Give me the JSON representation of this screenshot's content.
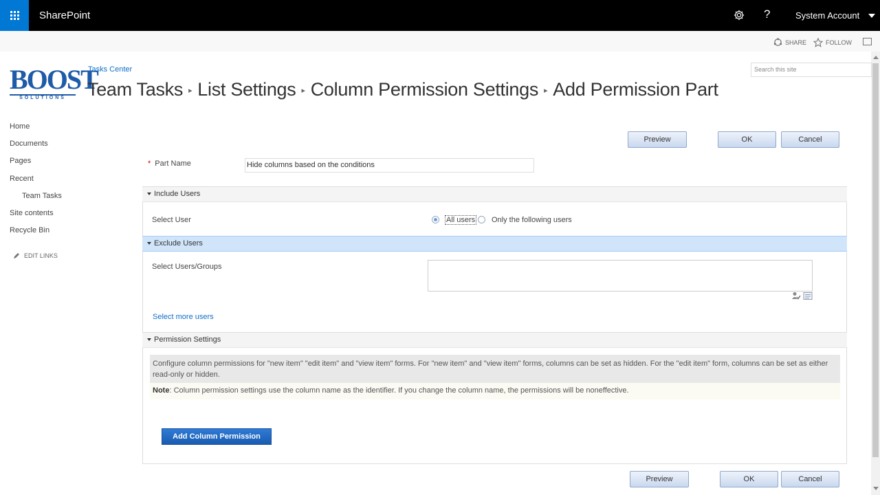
{
  "suite": {
    "brand": "SharePoint",
    "account": "System Account",
    "help": "?"
  },
  "ribbon": {
    "share": "SHARE",
    "follow": "FOLLOW"
  },
  "logo": {
    "main": "BOOST",
    "sub": "SOLUTIONS"
  },
  "header": {
    "site_title": "Tasks Center",
    "breadcrumb": [
      "Team Tasks",
      "List Settings",
      "Column Permission Settings",
      "Add Permission Part"
    ],
    "search_placeholder": "Search this site"
  },
  "nav": {
    "items": [
      "Home",
      "Documents",
      "Pages",
      "Recent",
      "Team Tasks",
      "Site contents",
      "Recycle Bin"
    ],
    "edit_links": "EDIT LINKS"
  },
  "buttons": {
    "preview": "Preview",
    "ok": "OK",
    "cancel": "Cancel",
    "add_column_permission": "Add Column Permission"
  },
  "form": {
    "part_name_label": "Part Name",
    "part_name_required": "*",
    "part_name_value": "Hide columns based on the conditions",
    "include_users": {
      "header": "Include Users",
      "select_user_label": "Select User",
      "options": [
        "All users",
        "Only the following users"
      ],
      "selected": "All users"
    },
    "exclude_users": {
      "header": "Exclude Users",
      "select_users_groups_label": "Select Users/Groups",
      "select_more_users": "Select more users"
    },
    "permission_settings": {
      "header": "Permission Settings",
      "description": "Configure column permissions for \"new item\" \"edit item\" and \"view item\" forms. For \"new item\" and \"view item\" forms, columns can be set as hidden. For the \"edit item\" form, columns can be set as either read-only or hidden.",
      "note_label": "Note",
      "note_text": ": Column permission settings use the column name as the identifier. If you change the column name, the permissions will be noneffective."
    }
  },
  "colors": {
    "suite_bar": "#000000",
    "waffle": "#0078d4",
    "link": "#0f6fc6",
    "active_section": "#d0e5fa",
    "primary_button": "#2266c0"
  }
}
